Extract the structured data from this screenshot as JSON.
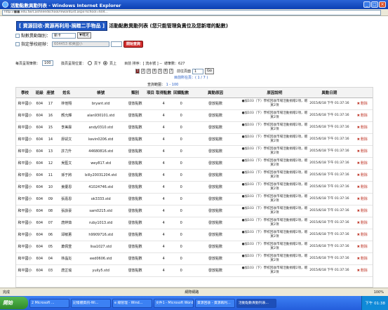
{
  "window": {
    "title": "活動點數異動列表 - Windows Internet Explorer"
  },
  "address": {
    "url": "http://■■.edu.tw/Cashneedschool/rewardList.aspx?school=604..."
  },
  "heading": {
    "unit": "[ 資源回收-資源再利用-捐贈二手物品 ]",
    "title": "活動點數異動列表 (您只能管理負責位及您新增的點數)"
  },
  "filters": {
    "row1_label": "點數異動類別：",
    "row1_value": "新卡",
    "row1_button": "▼確定",
    "row2_label": "指定學校經辦：",
    "row2_value": "604453 和美國小",
    "row2_button": "開始查詢"
  },
  "pager": {
    "per_page_label": "每頁呈現筆數：",
    "per_page_value": "100",
    "pos_label": "換頁呈現位置：",
    "pos_bottom": "頁下",
    "pos_top": "頁上",
    "current_label": "目前 排序：[ 流水號 ] --",
    "total_label": "總筆數：627",
    "pages": [
      "1",
      "2",
      "3",
      "4",
      "5",
      "6",
      "7"
    ],
    "goto_label": "前往頁面",
    "goto_value": "1",
    "goto_button": "Go",
    "page_info": "目前所在頁：( 1 / 7 )"
  },
  "range": {
    "label": "查詢範圍：",
    "value": "1 - 100"
  },
  "table": {
    "headers": [
      "學校",
      "班級",
      "座號",
      "姓名",
      "帳號",
      "類別",
      "項目",
      "取得點數",
      "回饋點數",
      "異動原因",
      "原因說明",
      "異動日期",
      ""
    ],
    "rows": [
      {
        "school": "和平國小",
        "cls": "604",
        "seat": "17",
        "name": "林他翔",
        "acct": "bryant.std",
        "cat": "發放點數",
        "pts": "4",
        "back": "0",
        "reason": "發放點數",
        "desc": "●加103（下）學校回收市場活動捐贈2項，贈買2項",
        "date": "2015/6/18 下午 01:37:16",
        "del": "刪除"
      },
      {
        "school": "和平國小",
        "cls": "604",
        "seat": "16",
        "name": "顏允輝",
        "acct": "alan930101.std",
        "cat": "發放點數",
        "pts": "4",
        "back": "0",
        "reason": "發放點數",
        "desc": "●加103（下）學校回收市場活動捐贈2項，贈買2項",
        "date": "2015/6/18 下午 01:37:16",
        "del": "刪除"
      },
      {
        "school": "和平國小",
        "cls": "604",
        "seat": "15",
        "name": "李美霖",
        "acct": "andy0310.std",
        "cat": "發放點數",
        "pts": "4",
        "back": "0",
        "reason": "發放點數",
        "desc": "●加103（下）學校回收市場活動捐贈2項，贈買2項",
        "date": "2015/6/18 下午 01:37:16",
        "del": "刪除"
      },
      {
        "school": "和平國小",
        "cls": "604",
        "seat": "14",
        "name": "廖凱文",
        "acct": "kevin0206.std",
        "cat": "發放點數",
        "pts": "4",
        "back": "0",
        "reason": "發放點數",
        "desc": "●加103（下）學校回收市場活動捐贈2項，贈買2項",
        "date": "2015/6/18 下午 01:37:16",
        "del": "刪除"
      },
      {
        "school": "和平國小",
        "cls": "604",
        "seat": "13",
        "name": "許力升",
        "acct": "44680816.std",
        "cat": "發放點數",
        "pts": "4",
        "back": "0",
        "reason": "發放點數",
        "desc": "●加103（下）學校回收市場活動捐贈2項，贈買2項",
        "date": "2015/6/18 下午 01:37:16",
        "del": "刪除"
      },
      {
        "school": "和平國小",
        "cls": "604",
        "seat": "12",
        "name": "吳藍文",
        "acct": "wey817.std",
        "cat": "發放點數",
        "pts": "4",
        "back": "0",
        "reason": "發放點數",
        "desc": "●加103（下）學校回收市場活動捐贈2項，贈買2項",
        "date": "2015/6/18 下午 01:37:16",
        "del": "刪除"
      },
      {
        "school": "和平國小",
        "cls": "604",
        "seat": "11",
        "name": "孫于將",
        "acct": "billy20031204.std",
        "cat": "發放點數",
        "pts": "4",
        "back": "0",
        "reason": "發放點數",
        "desc": "●加103（下）學校回收市場活動捐贈2項，贈買2項",
        "date": "2015/6/18 下午 01:37:16",
        "del": "刪除"
      },
      {
        "school": "和平國小",
        "cls": "604",
        "seat": "10",
        "name": "姜慶恩",
        "acct": "41024746.std",
        "cat": "發放點數",
        "pts": "4",
        "back": "0",
        "reason": "發放點數",
        "desc": "●加103（下）學校回收市場活動捐贈2項，贈買2項",
        "date": "2015/6/18 下午 01:37:16",
        "del": "刪除"
      },
      {
        "school": "和平國小",
        "cls": "604",
        "seat": "09",
        "name": "張嘉恩",
        "acct": "ok3333.std",
        "cat": "發放點數",
        "pts": "4",
        "back": "0",
        "reason": "發放點數",
        "desc": "●加103（下）學校回收市場活動捐贈2項，贈買2項",
        "date": "2015/6/18 下午 01:37:16",
        "del": "刪除"
      },
      {
        "school": "和平國小",
        "cls": "604",
        "seat": "08",
        "name": "張詠豪",
        "acct": "sam0215.std",
        "cat": "發放點數",
        "pts": "4",
        "back": "0",
        "reason": "發放點數",
        "desc": "●加103（下）學校回收市場活動捐贈2項，贈買2項",
        "date": "2015/6/18 下午 01:37:16",
        "del": "刪除"
      },
      {
        "school": "和平國小",
        "cls": "604",
        "seat": "07",
        "name": "唐婷茹",
        "acct": "ruby1013.std",
        "cat": "發放點數",
        "pts": "4",
        "back": "0",
        "reason": "發放點數",
        "desc": "●加103（下）學校回收市場活動捐贈2項，贈買2項",
        "date": "2015/6/18 下午 01:37:16",
        "del": "刪除"
      },
      {
        "school": "和平國小",
        "cls": "604",
        "seat": "06",
        "name": "邱敏蕙",
        "acct": "h9909716.std",
        "cat": "發放點數",
        "pts": "4",
        "back": "0",
        "reason": "發放點數",
        "desc": "●加103（下）學校回收市場活動捐贈2項，贈買2項",
        "date": "2015/6/18 下午 01:37:16",
        "del": "刪除"
      },
      {
        "school": "和平國小",
        "cls": "604",
        "seat": "05",
        "name": "蕭佩萱",
        "acct": "lisa1027.std",
        "cat": "發放點數",
        "pts": "4",
        "back": "0",
        "reason": "發放點數",
        "desc": "●加103（下）學校回收市場活動捐贈2項，贈買2項",
        "date": "2015/6/18 下午 01:37:16",
        "del": "刪除"
      },
      {
        "school": "和平國小",
        "cls": "604",
        "seat": "04",
        "name": "林晶彣",
        "acct": "eed0606.std",
        "cat": "發放點數",
        "pts": "4",
        "back": "0",
        "reason": "發放點數",
        "desc": "●加103（下）學校回收市場活動捐贈2項，贈買2項",
        "date": "2015/6/18 下午 01:37:16",
        "del": "刪除"
      },
      {
        "school": "和平國小",
        "cls": "604",
        "seat": "03",
        "name": "唐芷瑜",
        "acct": "yuily5.std",
        "cat": "發放點數",
        "pts": "4",
        "back": "0",
        "reason": "發放點數",
        "desc": "●加103（下）學校回收市場活動捐贈2項，贈買2項",
        "date": "2015/6/18 下午 01:37:16",
        "del": "刪除"
      }
    ]
  },
  "status": {
    "left": "完成",
    "zone": "網際網路",
    "zoom": "100%"
  },
  "taskbar": {
    "start": "開始",
    "tasks": [
      "2 Microsoft ...",
      "記憶體資訊-Wi...",
      "e 總管理 - Wind...",
      "文件1 - Microsoft Word",
      "資源回收 - 資源再利...",
      "活動點數異動列表..."
    ],
    "clock": "下午 01:38"
  }
}
